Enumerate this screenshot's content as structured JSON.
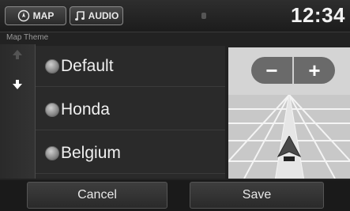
{
  "topbar": {
    "map_tab": "MAP",
    "audio_tab": "AUDIO",
    "clock": "12:34"
  },
  "section_label": "Map Theme",
  "themes": [
    {
      "label": "Default",
      "selected": false
    },
    {
      "label": "Honda",
      "selected": false
    },
    {
      "label": "Belgium",
      "selected": false
    }
  ],
  "preview": {
    "zoom_out": "−",
    "zoom_in": "+"
  },
  "actions": {
    "cancel": "Cancel",
    "save": "Save"
  }
}
